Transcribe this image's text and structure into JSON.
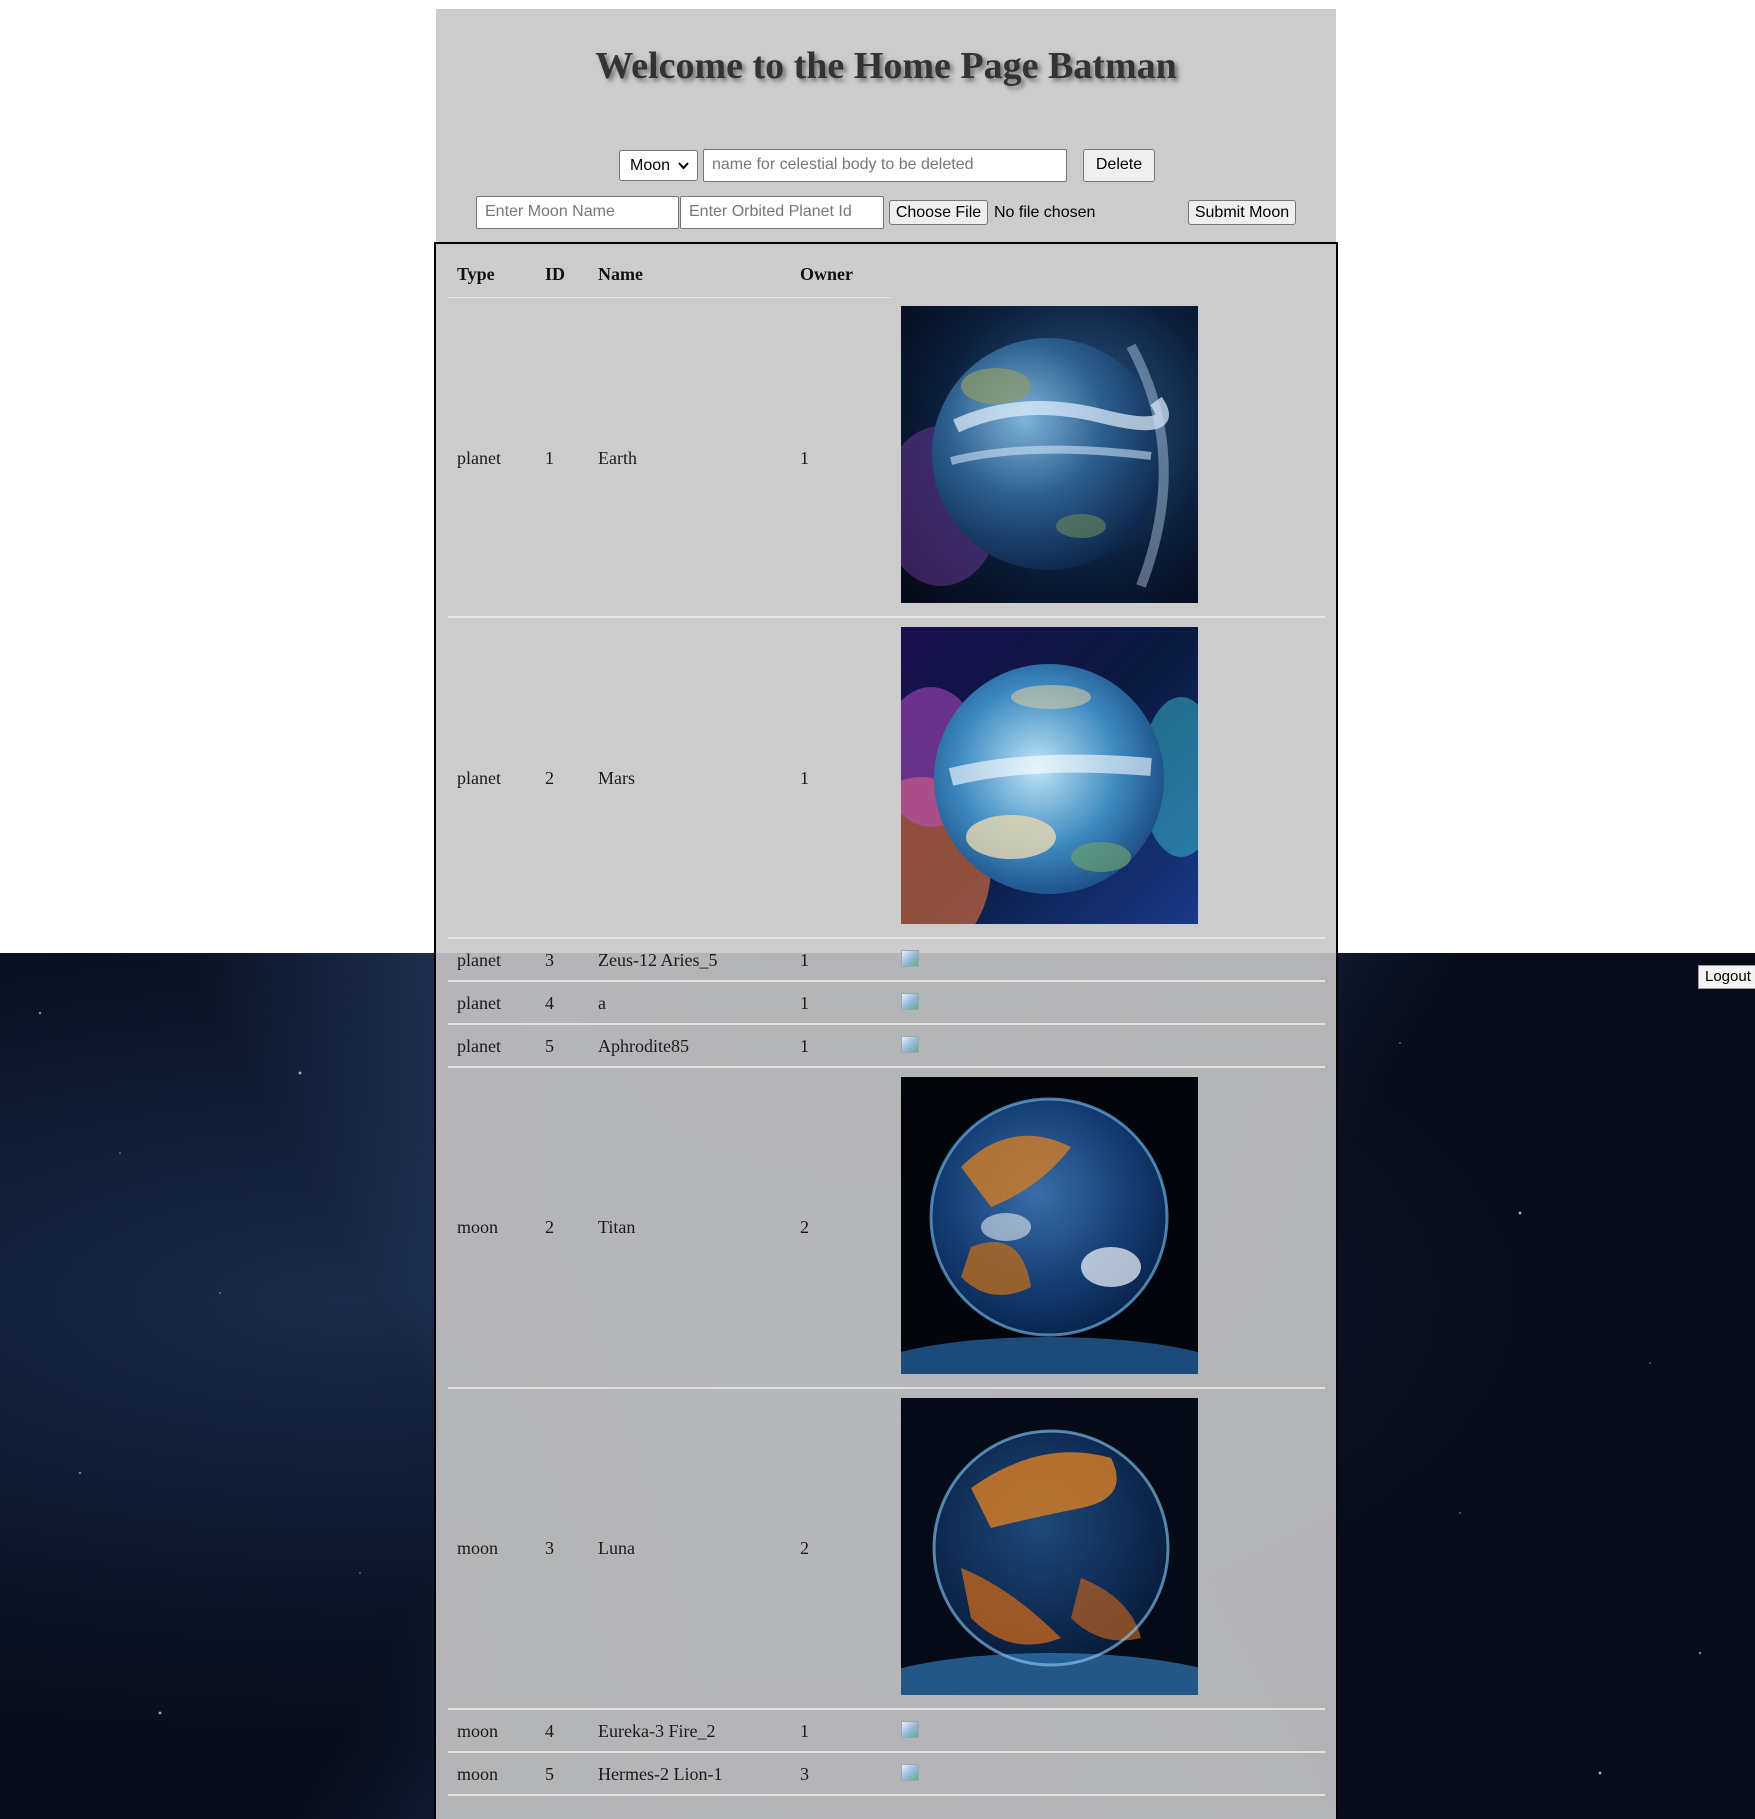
{
  "header": {
    "title": "Welcome to the Home Page Batman"
  },
  "delete_form": {
    "type_select": "Moon",
    "name_placeholder": "name for celestial body to be deleted",
    "delete_label": "Delete"
  },
  "moon_form": {
    "moon_name_placeholder": "Enter Moon Name",
    "planet_id_placeholder": "Enter Orbited Planet Id",
    "choose_file_label": "Choose File",
    "file_status": "No file chosen",
    "submit_label": "Submit Moon"
  },
  "logout_label": "Logout",
  "table": {
    "columns": [
      "Type",
      "ID",
      "Name",
      "Owner"
    ],
    "rows": [
      {
        "type": "planet",
        "id": "1",
        "name": "Earth",
        "owner": "1",
        "image": "earth-globe-image"
      },
      {
        "type": "planet",
        "id": "2",
        "name": "Mars",
        "owner": "1",
        "image": "colorful-globe-image"
      },
      {
        "type": "planet",
        "id": "3",
        "name": "Zeus-12 Aries_5",
        "owner": "1",
        "image": "broken-image-icon"
      },
      {
        "type": "planet",
        "id": "4",
        "name": "a",
        "owner": "1",
        "image": "broken-image-icon"
      },
      {
        "type": "planet",
        "id": "5",
        "name": "Aphrodite85",
        "owner": "1",
        "image": "broken-image-icon"
      },
      {
        "type": "moon",
        "id": "2",
        "name": "Titan",
        "owner": "2",
        "image": "orange-blue-globe-image"
      },
      {
        "type": "moon",
        "id": "3",
        "name": "Luna",
        "owner": "2",
        "image": "orange-globe-image"
      },
      {
        "type": "moon",
        "id": "4",
        "name": "Eureka-3 Fire_2",
        "owner": "1",
        "image": "broken-image-icon"
      },
      {
        "type": "moon",
        "id": "5",
        "name": "Hermes-2 Lion-1",
        "owner": "3",
        "image": "broken-image-icon"
      }
    ]
  }
}
